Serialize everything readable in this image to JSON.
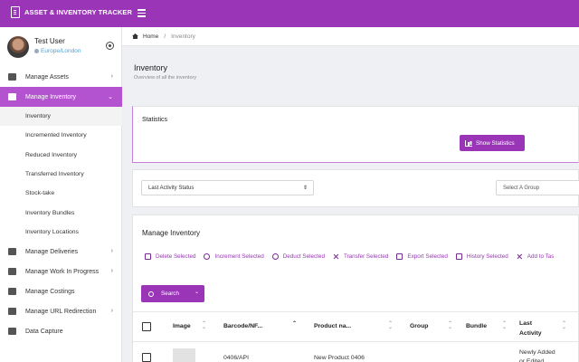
{
  "app": {
    "title": "ASSET & INVENTORY TRACKER"
  },
  "user": {
    "name": "Test User",
    "location": "Europe/London"
  },
  "nav": [
    {
      "label": "Manage Assets",
      "icon": "assets-icon",
      "has_children": true,
      "active": false
    },
    {
      "label": "Manage Inventory",
      "icon": "tag-icon",
      "has_children": true,
      "active": true,
      "children": [
        {
          "label": "Inventory",
          "current": true
        },
        {
          "label": "Incremented Inventory"
        },
        {
          "label": "Reduced Inventory"
        },
        {
          "label": "Transferred Inventory"
        },
        {
          "label": "Stock-take"
        },
        {
          "label": "Inventory Bundles"
        },
        {
          "label": "Inventory Locations"
        }
      ]
    },
    {
      "label": "Manage Deliveries",
      "icon": "truck-icon",
      "has_children": true
    },
    {
      "label": "Manage Work In Progress",
      "icon": "clipboard-icon",
      "has_children": true
    },
    {
      "label": "Manage Costings",
      "icon": "calculator-icon",
      "has_children": false
    },
    {
      "label": "Manage URL Redirection",
      "icon": "redirect-icon",
      "has_children": true
    },
    {
      "label": "Data Capture",
      "icon": "capture-icon",
      "has_children": false
    }
  ],
  "breadcrumb": {
    "home": "Home",
    "current": "Inventory"
  },
  "page": {
    "title": "Inventory",
    "subtitle": "Overview of all the inventory"
  },
  "statistics": {
    "title": "Statistics",
    "button": "Show Statistics"
  },
  "filters": {
    "activity_status": "Last Activity Status",
    "group": "Select A Group"
  },
  "manage": {
    "title": "Manage Inventory",
    "actions": [
      {
        "label": "Delete Selected",
        "icon": "trash-icon"
      },
      {
        "label": "Increment Selected",
        "icon": "plus-circle-icon"
      },
      {
        "label": "Deduct Selected",
        "icon": "minus-circle-icon"
      },
      {
        "label": "Transfer Selected",
        "icon": "transfer-icon"
      },
      {
        "label": "Export Selected",
        "icon": "export-icon"
      },
      {
        "label": "History Selected",
        "icon": "history-icon"
      },
      {
        "label": "Add to Tas",
        "icon": "add-task-icon"
      }
    ],
    "search_button": "Search"
  },
  "table": {
    "columns": [
      "Image",
      "Barcode/NF...",
      "Product na...",
      "Group",
      "Bundle",
      "Last Activity"
    ],
    "rows": [
      {
        "barcode": "0406/API",
        "product": "New Product 0406",
        "group": "",
        "bundle": "",
        "last_activity": "Newly Added or Edited"
      }
    ]
  },
  "colors": {
    "brand": "#9a35b7",
    "active_nav": "#b453cf"
  }
}
